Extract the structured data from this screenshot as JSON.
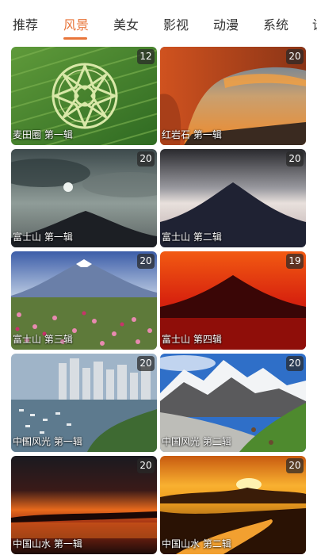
{
  "tabs": [
    {
      "label": "推荐",
      "active": false
    },
    {
      "label": "风景",
      "active": true
    },
    {
      "label": "美女",
      "active": false
    },
    {
      "label": "影视",
      "active": false
    },
    {
      "label": "动漫",
      "active": false
    },
    {
      "label": "系统",
      "active": false
    },
    {
      "label": "设",
      "active": false
    }
  ],
  "colors": {
    "accent": "#e8753a",
    "tab_text": "#333333",
    "badge_bg": "#282828"
  },
  "albums": [
    {
      "title": "麦田圈 第一辑",
      "count": "12",
      "image": "crop-circle-field"
    },
    {
      "title": "红岩石 第一辑",
      "count": "20",
      "image": "red-rock-arch"
    },
    {
      "title": "富士山 第一辑",
      "count": "20",
      "image": "fuji-cloudy-sky"
    },
    {
      "title": "富士山 第二辑",
      "count": "20",
      "image": "fuji-dark-silhouette"
    },
    {
      "title": "富士山 第三辑",
      "count": "20",
      "image": "fuji-flower-field"
    },
    {
      "title": "富士山 第四辑",
      "count": "19",
      "image": "fuji-red-sky"
    },
    {
      "title": "中国风光 第一辑",
      "count": "20",
      "image": "harbor-city"
    },
    {
      "title": "中国风光 第二辑",
      "count": "20",
      "image": "snow-mountain-valley"
    },
    {
      "title": "中国山水 第一辑",
      "count": "20",
      "image": "sunset-lake"
    },
    {
      "title": "中国山水 第二辑",
      "count": "20",
      "image": "golden-river-sunset"
    }
  ]
}
